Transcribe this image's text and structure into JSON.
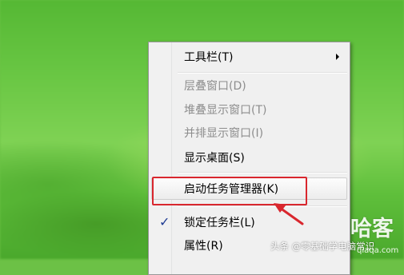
{
  "menu": {
    "items": [
      {
        "label": "工具栏(T)",
        "disabled": false,
        "submenu": true
      },
      {
        "label": "层叠窗口(D)",
        "disabled": true
      },
      {
        "label": "堆叠显示窗口(T)",
        "disabled": true
      },
      {
        "label": "并排显示窗口(I)",
        "disabled": true
      },
      {
        "label": "显示桌面(S)",
        "disabled": false
      },
      {
        "label": "启动任务管理器(K)",
        "disabled": false,
        "highlighted": true
      },
      {
        "label": "锁定任务栏(L)",
        "disabled": false,
        "checked": true
      },
      {
        "label": "属性(R)",
        "disabled": false
      }
    ],
    "check_glyph": "✓"
  },
  "annotation": {
    "highlight_color": "#d9272e"
  },
  "watermark": {
    "text": "头条 @零基础学电脑常识",
    "logo": "哈客",
    "site": "qiaqa.com"
  }
}
